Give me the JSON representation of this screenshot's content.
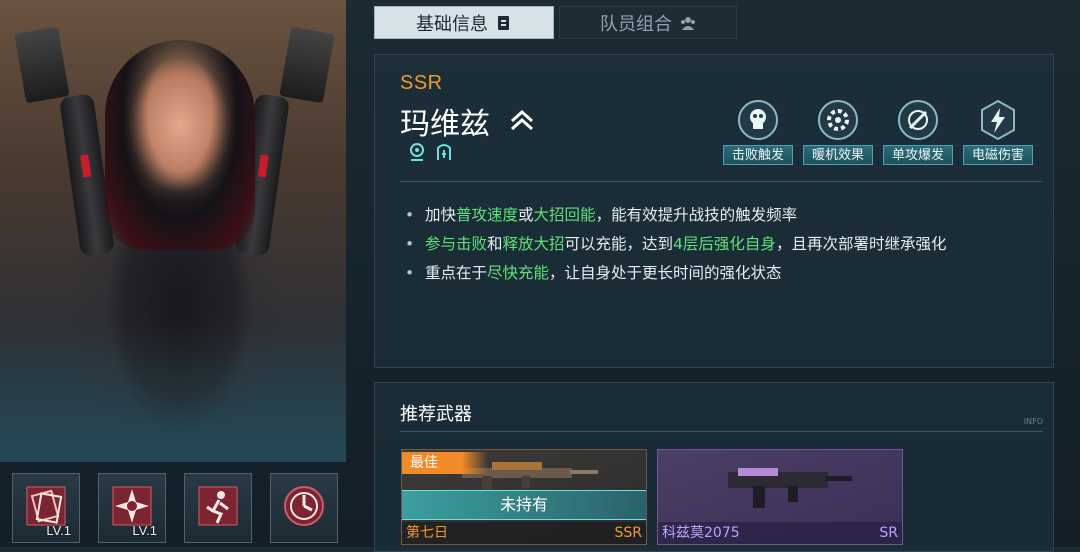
{
  "tabs": {
    "basic_info": "基础信息",
    "team": "队员组合",
    "active": "basic_info"
  },
  "character": {
    "rarity": "SSR",
    "name": "玛维兹",
    "rank_icon": "chevron-up-double-icon",
    "role_icons": [
      "radar-pin-icon",
      "shield-a-icon"
    ]
  },
  "tags": [
    {
      "label": "击败触发",
      "icon": "skull-icon"
    },
    {
      "label": "暖机效果",
      "icon": "gear-heat-icon"
    },
    {
      "label": "单攻爆发",
      "icon": "target-slash-icon"
    },
    {
      "label": "电磁伤害",
      "icon": "lightning-icon"
    }
  ],
  "description": [
    {
      "parts": [
        {
          "t": "加快",
          "hl": false
        },
        {
          "t": "普攻速度",
          "hl": true
        },
        {
          "t": "或",
          "hl": false
        },
        {
          "t": "大招回能",
          "hl": true
        },
        {
          "t": "，能有效提升战技的触发频率",
          "hl": false
        }
      ]
    },
    {
      "parts": [
        {
          "t": "参与击败",
          "hl": true
        },
        {
          "t": "和",
          "hl": false
        },
        {
          "t": "释放大招",
          "hl": true
        },
        {
          "t": "可以充能，达到",
          "hl": false
        },
        {
          "t": "4层后强化自身",
          "hl": true
        },
        {
          "t": "，且再次部署时继承强化",
          "hl": false
        }
      ]
    },
    {
      "parts": [
        {
          "t": "重点在于",
          "hl": false
        },
        {
          "t": "尽快充能",
          "hl": true
        },
        {
          "t": "，让自身处于更长时间的强化状态",
          "hl": false
        }
      ]
    }
  ],
  "weapons": {
    "title": "推荐武器",
    "info_text": "INFO",
    "items": [
      {
        "badge": "最佳",
        "status": "未持有",
        "name": "第七日",
        "rarity": "SSR"
      },
      {
        "badge": "",
        "status": "",
        "name": "科兹莫2075",
        "rarity": "SR"
      }
    ]
  },
  "skills": [
    {
      "icon": "cards-burst-icon",
      "level": "LV.1"
    },
    {
      "icon": "star-burst-icon",
      "level": "LV.1"
    },
    {
      "icon": "figure-dash-icon",
      "level": ""
    },
    {
      "icon": "timer-dial-icon",
      "level": ""
    }
  ],
  "colors": {
    "accent_orange": "#f19a2b",
    "highlight_green": "#5fe27a",
    "tag_teal": "#2e6c7a",
    "sr_purple": "#b9a5ff"
  }
}
